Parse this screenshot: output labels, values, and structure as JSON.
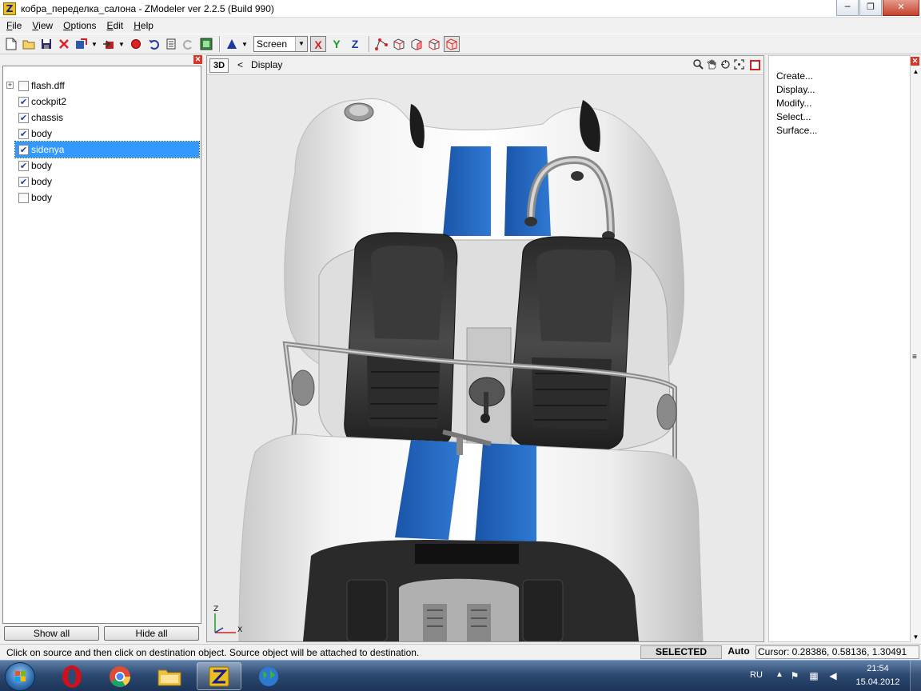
{
  "window": {
    "title": "кобра_переделка_салона - ZModeler ver 2.2.5 (Build 990)",
    "app_icon_letter": "Z",
    "minimize": "─",
    "maximize": "❐",
    "close": "✕"
  },
  "menu": [
    {
      "label": "File",
      "accel": "F",
      "rest": "ile"
    },
    {
      "label": "View",
      "accel": "V",
      "rest": "iew"
    },
    {
      "label": "Options",
      "accel": "O",
      "rest": "ptions"
    },
    {
      "label": "Edit",
      "accel": "E",
      "rest": "dit"
    },
    {
      "label": "Help",
      "accel": "H",
      "rest": "elp"
    }
  ],
  "toolbar": {
    "view_mode": "Screen",
    "axis_x": "X",
    "axis_y": "Y",
    "axis_z": "Z"
  },
  "tree": {
    "close": "✕",
    "items": [
      {
        "label": "flash.dff",
        "checked": false,
        "expandable": true,
        "selected": false
      },
      {
        "label": "cockpit2",
        "checked": true,
        "expandable": false,
        "selected": false
      },
      {
        "label": "chassis",
        "checked": true,
        "expandable": false,
        "selected": false
      },
      {
        "label": "body",
        "checked": true,
        "expandable": false,
        "selected": false
      },
      {
        "label": "sidenya",
        "checked": true,
        "expandable": false,
        "selected": true
      },
      {
        "label": "body",
        "checked": true,
        "expandable": false,
        "selected": false
      },
      {
        "label": "body",
        "checked": true,
        "expandable": false,
        "selected": false
      },
      {
        "label": "body",
        "checked": false,
        "expandable": false,
        "selected": false
      }
    ],
    "show_all": "Show all",
    "hide_all": "Hide all"
  },
  "viewport": {
    "mode_label": "3D",
    "back_arrow": "<",
    "panel_label": "Display",
    "gizmo_z": "Z",
    "gizmo_x": "X"
  },
  "command_panel": {
    "close": "✕",
    "items": [
      "Create...",
      "Display...",
      "Modify...",
      "Select...",
      "Surface..."
    ]
  },
  "status": {
    "message": "Click on source and then click on destination object. Source object will be attached to destination.",
    "mode": "SELECTED MODE",
    "auto": "Auto",
    "cursor": "Cursor: 0.28386, 0.58136, 1.30491"
  },
  "taskbar": {
    "language": "RU",
    "time": "21:54",
    "date": "15.04.2012"
  },
  "colors": {
    "selection": "#3399ff",
    "stripe_blue": "#1f62b8",
    "close_red": "#d0392b"
  }
}
